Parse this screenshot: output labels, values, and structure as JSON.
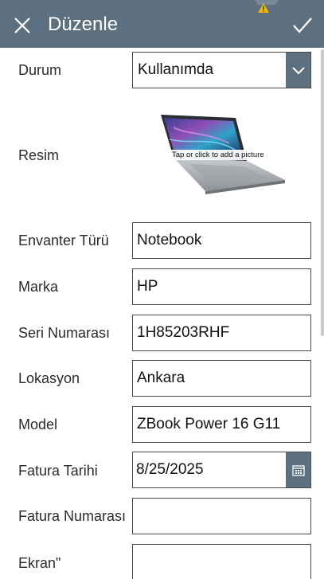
{
  "header": {
    "title": "Düzenle",
    "accent_color": "#5d707f",
    "close_icon": "close-icon",
    "confirm_icon": "checkmark-icon",
    "warning_icon": "warning-icon"
  },
  "form": {
    "status": {
      "label": "Durum",
      "value": "Kullanımda"
    },
    "image": {
      "label": "Resim",
      "hint": "Tap or click to add a picture"
    },
    "inventory_type": {
      "label": "Envanter Türü",
      "value": "Notebook"
    },
    "brand": {
      "label": "Marka",
      "value": "HP"
    },
    "serial": {
      "label": "Seri Numarası",
      "value": "1H85203RHF"
    },
    "location": {
      "label": "Lokasyon",
      "value": "Ankara"
    },
    "model": {
      "label": "Model",
      "value": "ZBook Power 16 G11"
    },
    "invoice_date": {
      "label": "Fatura Tarihi",
      "value": "8/25/2025"
    },
    "invoice_number": {
      "label": "Fatura Numarası",
      "value": ""
    },
    "screen": {
      "label": "Ekran\"",
      "value": ""
    }
  }
}
